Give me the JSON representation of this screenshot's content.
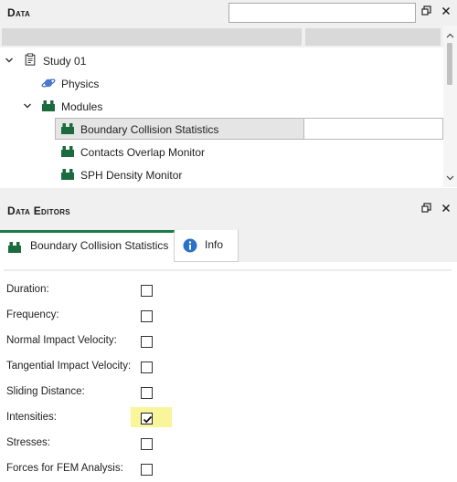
{
  "data_panel": {
    "title": "Data",
    "search": {
      "value": "",
      "placeholder": ""
    },
    "tree": [
      {
        "label": "Study 01",
        "icon": "clipboard-icon"
      },
      {
        "label": "Physics",
        "icon": "planet-icon"
      },
      {
        "label": "Modules",
        "icon": "modules-icon"
      },
      {
        "label": "Boundary Collision Statistics",
        "icon": "module-icon",
        "selected": true
      },
      {
        "label": "Contacts Overlap Monitor",
        "icon": "module-icon"
      },
      {
        "label": "SPH Density Monitor",
        "icon": "module-icon"
      }
    ]
  },
  "editors_panel": {
    "title": "Data Editors",
    "tabs": [
      {
        "label": "Boundary Collision Statistics",
        "icon": "module-icon",
        "active": true
      },
      {
        "label": "Info",
        "icon": "info-icon",
        "active": false
      }
    ],
    "properties": [
      {
        "label": "Duration:",
        "checked": false
      },
      {
        "label": "Frequency:",
        "checked": false
      },
      {
        "label": "Normal Impact Velocity:",
        "checked": false
      },
      {
        "label": "Tangential Impact Velocity:",
        "checked": false
      },
      {
        "label": "Sliding Distance:",
        "checked": false
      },
      {
        "label": "Intensities:",
        "checked": true,
        "highlighted": true
      },
      {
        "label": "Stresses:",
        "checked": false
      },
      {
        "label": "Forces for FEM Analysis:",
        "checked": false
      }
    ]
  },
  "colors": {
    "accent_green": "#1b6b3f",
    "tab_border": "#1b7a45",
    "info_blue": "#2a72c9",
    "highlight_yellow": "#f8f59a",
    "planet_blue": "#4a78d0"
  }
}
